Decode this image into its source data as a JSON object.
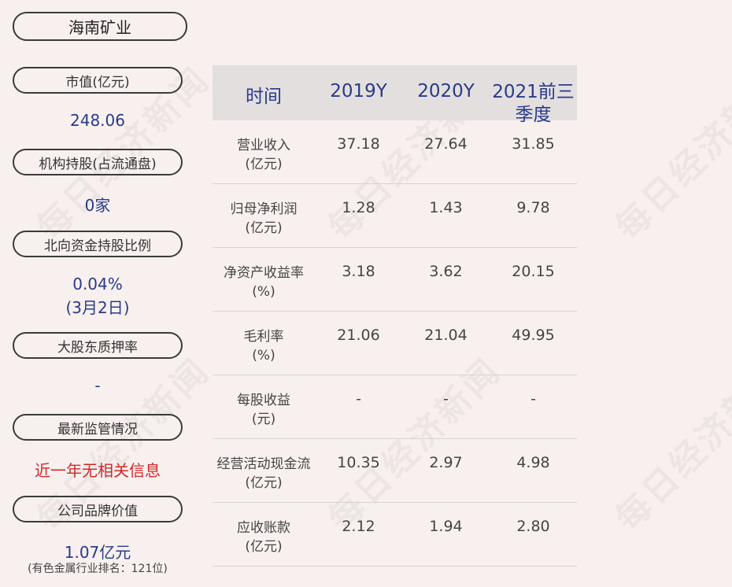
{
  "company": "海南矿业",
  "watermark": "每日经济新闻",
  "sidebar": {
    "market_cap_label": "市值(亿元)",
    "market_cap_value": "248.06",
    "inst_label": "机构持股(占流通盘)",
    "inst_value": "0家",
    "north_label": "北向资金持股比例",
    "north_value": "0.04%",
    "north_date": "(3月2日)",
    "pledge_label": "大股东质押率",
    "pledge_value": "-",
    "supervision_label": "最新监管情况",
    "supervision_value": "近一年无相关信息",
    "brand_label": "公司品牌价值",
    "brand_value": "1.07亿元",
    "brand_note": "(有色金属行业排名：121位)"
  },
  "table": {
    "headers": [
      "时间",
      "2019Y",
      "2020Y",
      "2021前三季度"
    ],
    "rows": [
      {
        "label1": "营业收入",
        "label2": "(亿元)",
        "v": [
          "37.18",
          "27.64",
          "31.85"
        ]
      },
      {
        "label1": "归母净利润",
        "label2": "(亿元)",
        "v": [
          "1.28",
          "1.43",
          "9.78"
        ]
      },
      {
        "label1": "净资产收益率",
        "label2": "(%)",
        "v": [
          "3.18",
          "3.62",
          "20.15"
        ]
      },
      {
        "label1": "毛利率",
        "label2": "(%)",
        "v": [
          "21.06",
          "21.04",
          "49.95"
        ]
      },
      {
        "label1": "每股收益",
        "label2": "(元)",
        "v": [
          "-",
          "-",
          "-"
        ]
      },
      {
        "label1": "经营活动现金流",
        "label2": "(亿元)",
        "v": [
          "10.35",
          "2.97",
          "4.98"
        ]
      },
      {
        "label1": "应收账款",
        "label2": "(亿元)",
        "v": [
          "2.12",
          "1.94",
          "2.80"
        ]
      }
    ]
  }
}
